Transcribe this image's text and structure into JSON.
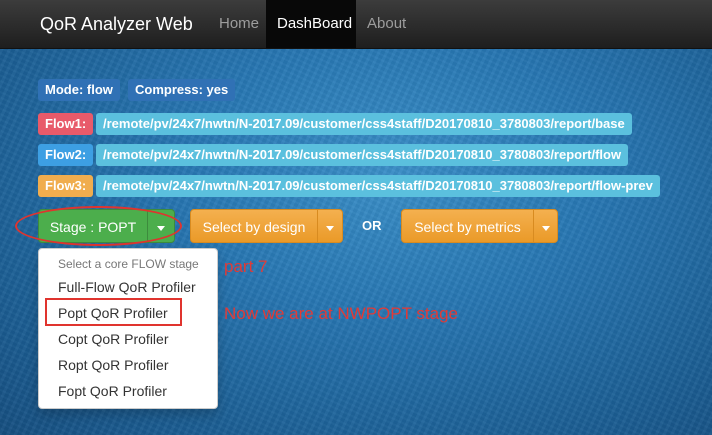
{
  "navbar": {
    "brand": "QoR Analyzer Web",
    "items": [
      "Home",
      "DashBoard",
      "About"
    ]
  },
  "badges": {
    "mode": "Mode: flow",
    "compress": "Compress: yes"
  },
  "flows": [
    {
      "label": "Flow1:",
      "path": "/remote/pv/24x7/nwtn/N-2017.09/customer/css4staff/D20170810_3780803/report/base"
    },
    {
      "label": "Flow2:",
      "path": "/remote/pv/24x7/nwtn/N-2017.09/customer/css4staff/D20170810_3780803/report/flow"
    },
    {
      "label": "Flow3:",
      "path": "/remote/pv/24x7/nwtn/N-2017.09/customer/css4staff/D20170810_3780803/report/flow-prev"
    }
  ],
  "controls": {
    "stage_label": "Stage : POPT",
    "select_design": "Select by design",
    "or_text": "OR",
    "select_metrics": "Select by metrics"
  },
  "dropdown": {
    "header": "Select a core FLOW stage",
    "items": [
      "Full-Flow QoR Profiler",
      "Popt QoR Profiler",
      "Copt QoR Profiler",
      "Ropt QoR Profiler",
      "Fopt QoR Profiler"
    ]
  },
  "annotations": {
    "part": "part 7",
    "note": "Now we are at NWPOPT stage"
  },
  "colors": {
    "navbar": "#222222",
    "stage_button": "#4cae4c",
    "select_buttons": "#f0ad4e",
    "annotation": "#e23a36"
  }
}
